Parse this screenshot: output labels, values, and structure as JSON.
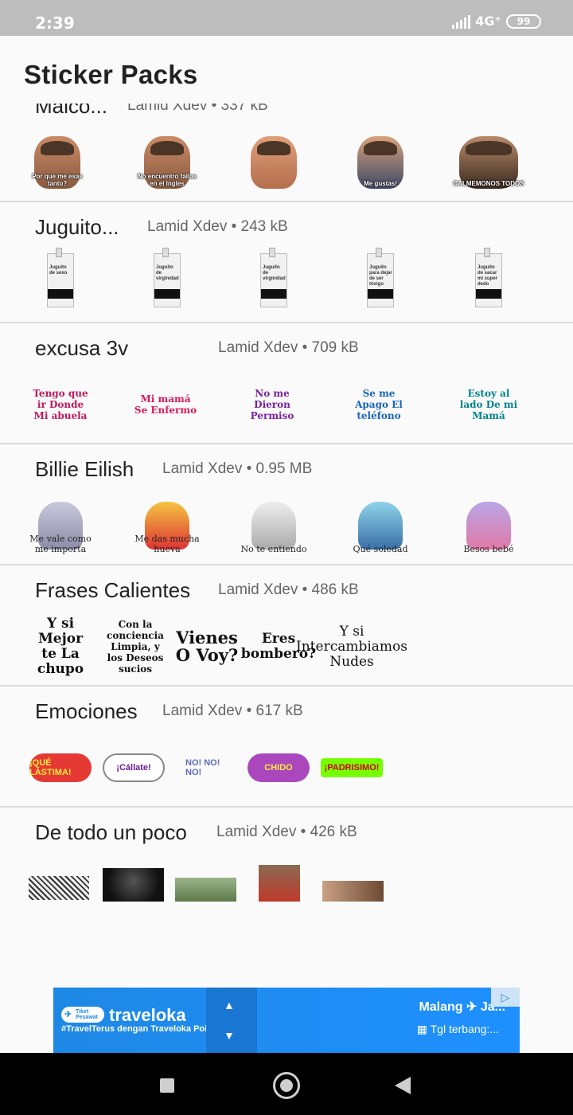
{
  "status_bar": {
    "time": "2:39",
    "network": "4G⁺",
    "battery": "99"
  },
  "app_bar": {
    "title": "Sticker Packs"
  },
  "packs": [
    {
      "name": "Malco...",
      "meta": "Lamid Xdev • 337 kB",
      "captions": [
        "Por que me esas tanto?",
        "No encuentro fallas en el Ingles",
        "",
        "Me gustas!",
        "CALMEMONOS TODOS"
      ]
    },
    {
      "name": "Juguito...",
      "meta": "Lamid Xdev • 243 kB",
      "captions": [
        "Juguito de sexo",
        "Juguito de virginidad",
        "Juguito de virginidad",
        "Juguito para dejar de ser tóxigo",
        "Juguito de sacar mi super dedo"
      ]
    },
    {
      "name": "excusa 3v",
      "meta": "Lamid Xdev • 709 kB",
      "captions": [
        "Tengo que ir Donde Mi abuela",
        "Mi mamá Se Enfermo",
        "No me Dieron Permiso",
        "Se me Apago El teléfono",
        "Estoy al lado De mi Mamá"
      ]
    },
    {
      "name": "Billie Eilish",
      "meta": "Lamid Xdev • 0.95 MB",
      "captions": [
        "Me vale como me importa",
        "Me das mucha hueva",
        "No te entiendo",
        "Qué soledad",
        "Besos bebé"
      ]
    },
    {
      "name": "Frases Calientes",
      "meta": "Lamid Xdev • 486 kB",
      "captions": [
        "Y si Mejor te La chupo",
        "Con la conciencia Limpia, y los Deseos sucios",
        "Vienes O Voy?",
        "Eres bombero?",
        "Y si Intercambiamos Nudes"
      ]
    },
    {
      "name": "Emociones",
      "meta": "Lamid Xdev • 617 kB",
      "captions": [
        "¡QUÉ LÁSTIMA!",
        "¡Cállate!",
        "NO! NO! NO!",
        "CHIDO",
        "¡PADRISIMO!"
      ]
    },
    {
      "name": "De todo un poco",
      "meta": "Lamid Xdev • 426 kB",
      "captions": [
        "",
        "",
        "",
        "",
        ""
      ]
    }
  ],
  "ad": {
    "brand": "traveloka",
    "badge": "Tiket Pesawat",
    "tagline": "#TravelTerus dengan Traveloka Poin",
    "destination": "Malang ✈ Ja...",
    "date": "Tgl terbang:..."
  }
}
